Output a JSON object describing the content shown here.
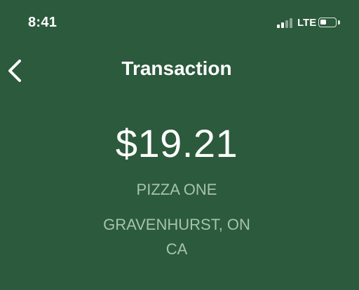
{
  "status_bar": {
    "time": "8:41",
    "network": "LTE",
    "signal_bars_active": 2,
    "signal_bars_total": 4,
    "battery_level": 0.4
  },
  "header": {
    "title": "Transaction",
    "back_icon": "chevron-left-icon"
  },
  "transaction": {
    "amount": "$19.21",
    "merchant": "PIZZA ONE",
    "location_line1": "GRAVENHURST, ON",
    "location_line2": "CA"
  },
  "colors": {
    "background": "#2c5a3c",
    "primary_text": "#ffffff",
    "secondary_text": "#a6c3ae"
  }
}
